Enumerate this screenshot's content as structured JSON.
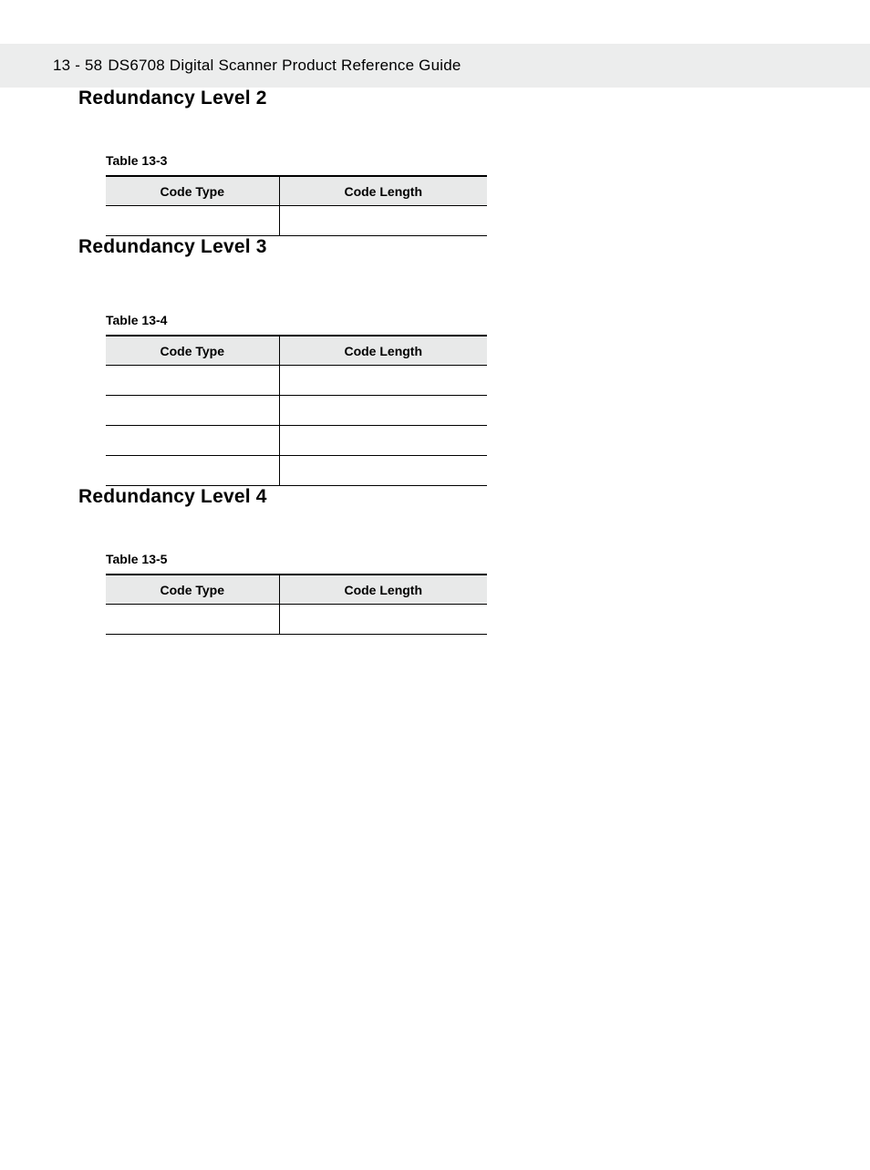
{
  "header": {
    "page_number": "13 - 58",
    "title": "DS6708 Digital Scanner Product Reference Guide"
  },
  "sections": [
    {
      "heading": "Redundancy Level 2",
      "table": {
        "caption": "Table 13-3",
        "columns": [
          "Code Type",
          "Code Length"
        ],
        "row_count": 1
      }
    },
    {
      "heading": "Redundancy Level 3",
      "table": {
        "caption": "Table 13-4",
        "columns": [
          "Code Type",
          "Code Length"
        ],
        "row_count": 4
      }
    },
    {
      "heading": "Redundancy Level 4",
      "table": {
        "caption": "Table 13-5",
        "columns": [
          "Code Type",
          "Code Length"
        ],
        "row_count": 1
      }
    }
  ]
}
